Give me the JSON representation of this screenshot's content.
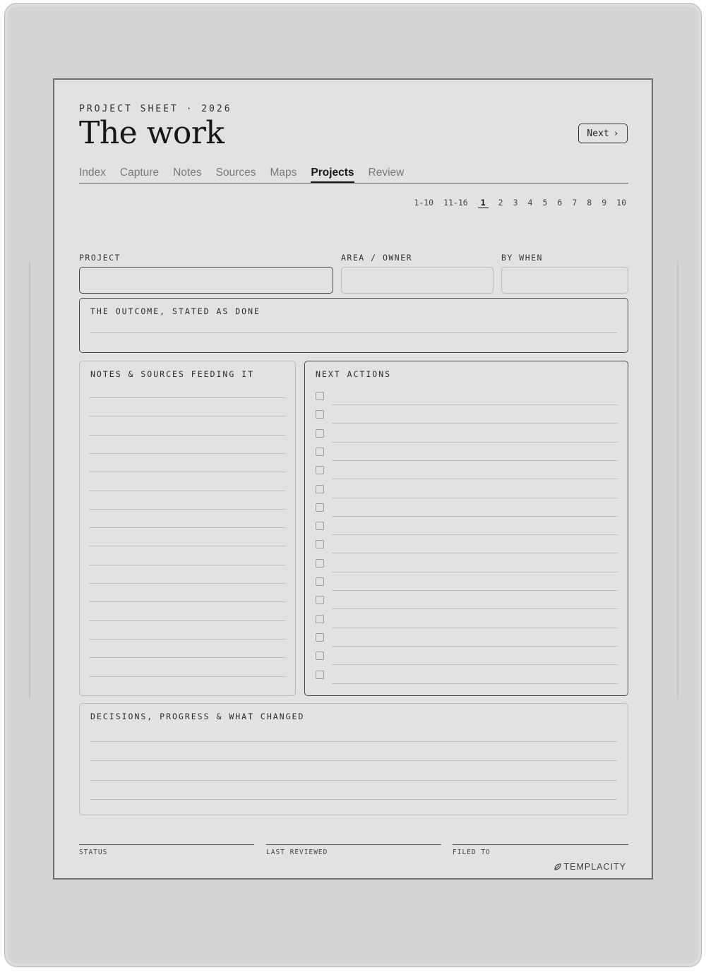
{
  "header": {
    "kicker": "PROJECT SHEET · 2026",
    "title": "The work",
    "next_label": "Next",
    "next_chevron": "›"
  },
  "tabs": [
    {
      "label": "Index",
      "active": false
    },
    {
      "label": "Capture",
      "active": false
    },
    {
      "label": "Notes",
      "active": false
    },
    {
      "label": "Sources",
      "active": false
    },
    {
      "label": "Maps",
      "active": false
    },
    {
      "label": "Projects",
      "active": true
    },
    {
      "label": "Review",
      "active": false
    }
  ],
  "pagination": {
    "items": [
      "1-10",
      "11-16",
      "1",
      "2",
      "3",
      "4",
      "5",
      "6",
      "7",
      "8",
      "9",
      "10"
    ],
    "active": "1"
  },
  "fields": {
    "project_label": "PROJECT",
    "area_label": "AREA / OWNER",
    "by_when_label": "BY WHEN"
  },
  "sections": {
    "outcome_label": "THE OUTCOME, STATED AS DONE",
    "notes_label": "NOTES & SOURCES FEEDING IT",
    "actions_label": "NEXT ACTIONS",
    "decisions_label": "DECISIONS, PROGRESS & WHAT CHANGED"
  },
  "footer": {
    "status_label": "STATUS",
    "last_reviewed_label": "LAST REVIEWED",
    "filed_to_label": "FILED TO",
    "brand": "TEMPLACITY",
    "brand_icon": "leaf-icon"
  },
  "colors": {
    "screen_bg": "#e2e2e2",
    "ink": "#1f1f1f",
    "device_frame": "#d4d4d2"
  }
}
